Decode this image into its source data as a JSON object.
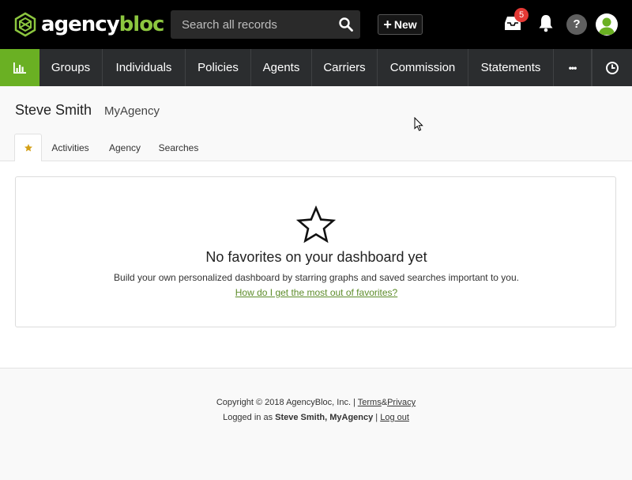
{
  "brand": {
    "name_part1": "agency",
    "name_part2": "bloc",
    "accent_color": "#8cc63f",
    "nav_home_color": "#6ab023"
  },
  "header": {
    "search_placeholder": "Search all records",
    "new_button_label": "New",
    "inbox_badge": "5",
    "help_label": "?"
  },
  "nav": {
    "items": [
      {
        "label": "Groups"
      },
      {
        "label": "Individuals"
      },
      {
        "label": "Policies"
      },
      {
        "label": "Agents"
      },
      {
        "label": "Carriers"
      },
      {
        "label": "Commission"
      },
      {
        "label": "Statements"
      }
    ],
    "more_label": "•••"
  },
  "page": {
    "title": "Steve Smith",
    "subtitle": "MyAgency",
    "tabs": [
      {
        "label": "Activities"
      },
      {
        "label": "Agency"
      },
      {
        "label": "Searches"
      }
    ]
  },
  "empty_state": {
    "title": "No favorites on your dashboard yet",
    "description": "Build your own personalized dashboard by starring graphs and saved searches important to you.",
    "link_text": "How do I get the most out of favorites?"
  },
  "footer": {
    "copyright": "Copyright © 2018 AgencyBloc, Inc. |",
    "terms": "Terms",
    "amp": "&",
    "privacy": "Privacy",
    "logged_in_prefix": "Logged in as",
    "logged_in_user": "Steve Smith, MyAgency",
    "separator": "|",
    "logout": "Log out"
  }
}
